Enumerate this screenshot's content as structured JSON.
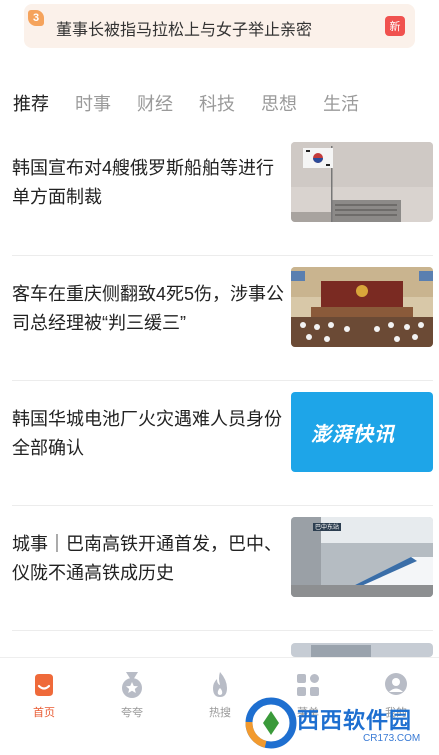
{
  "hot_banner": {
    "rank": "3",
    "title": "董事长被指马拉松上与女子举止亲密",
    "badge": "新"
  },
  "tabs": [
    {
      "label": "推荐",
      "active": true
    },
    {
      "label": "时事",
      "active": false
    },
    {
      "label": "财经",
      "active": false
    },
    {
      "label": "科技",
      "active": false
    },
    {
      "label": "思想",
      "active": false
    },
    {
      "label": "生活",
      "active": false
    }
  ],
  "news": [
    {
      "title": "韩国宣布对4艘俄罗斯船舶等进行单方面制裁",
      "thumb": "korean-flag-building-image"
    },
    {
      "title": "客车在重庆侧翻致4死5伤，涉事公司总经理被“判三缓三”",
      "thumb": "courtroom-image"
    },
    {
      "title": "韩国华城电池厂火灾遇难人员身份全部确认",
      "thumb": "thepaper-flash-logo-image",
      "thumb_text": "澎湃快讯"
    },
    {
      "title": "城事｜巴南高铁开通首发，巴中、仪陇不通高铁成历史",
      "thumb": "high-speed-train-image",
      "station_sign": "巴中东站"
    }
  ],
  "bottom_nav": [
    {
      "label": "首页",
      "icon": "home-icon",
      "active": true
    },
    {
      "label": "夸夸",
      "icon": "medal-icon",
      "active": false
    },
    {
      "label": "热搜",
      "icon": "flame-icon",
      "active": false
    },
    {
      "label": "菜单",
      "icon": "menu-grid-icon",
      "active": false
    },
    {
      "label": "我的",
      "icon": "profile-icon",
      "active": false
    }
  ],
  "watermark": {
    "text": "西西软件园",
    "sub": "CR173.COM"
  },
  "colors": {
    "accent": "#e85b32",
    "banner_bg": "#fbf1ea",
    "badge": "#f0524f",
    "tab_inactive": "#9a9a9a"
  }
}
